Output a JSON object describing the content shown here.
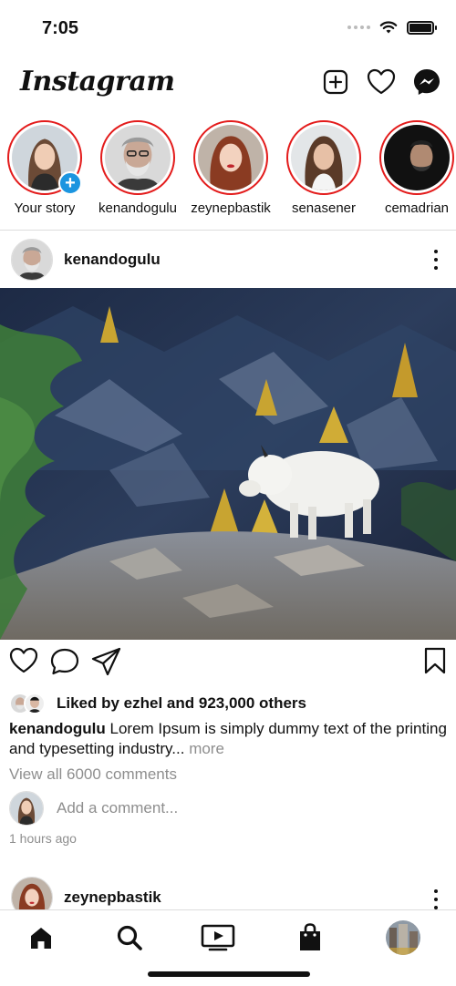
{
  "status_bar": {
    "time": "7:05"
  },
  "header": {
    "logo": "Instagram",
    "icons": [
      "new-post-icon",
      "heart-icon",
      "messenger-icon"
    ]
  },
  "stories": [
    {
      "label": "Your story",
      "is_own": true
    },
    {
      "label": "kenandogulu"
    },
    {
      "label": "zeynepbastik"
    },
    {
      "label": "senasener"
    },
    {
      "label": "cemadrian"
    }
  ],
  "post": {
    "username": "kenandogulu",
    "image_description_icon": "photo",
    "likes_text": "Liked by ezhel and 923,000 others",
    "caption_user": "kenandogulu",
    "caption_text": " Lorem Ipsum is simply dummy text of the printing and typesetting industry...",
    "caption_more": " more",
    "view_comments": "View all 6000 comments",
    "add_comment_placeholder": "Add a comment...",
    "timestamp": "1 hours ago"
  },
  "next_post": {
    "username": "zeynepbastik"
  },
  "bottom_nav": [
    "home-icon",
    "search-icon",
    "reels-icon",
    "shop-icon",
    "profile-avatar"
  ],
  "colors": {
    "story_ring": "#e31b1b",
    "add_badge": "#1b95e0",
    "muted_text": "#8e8e8e"
  }
}
